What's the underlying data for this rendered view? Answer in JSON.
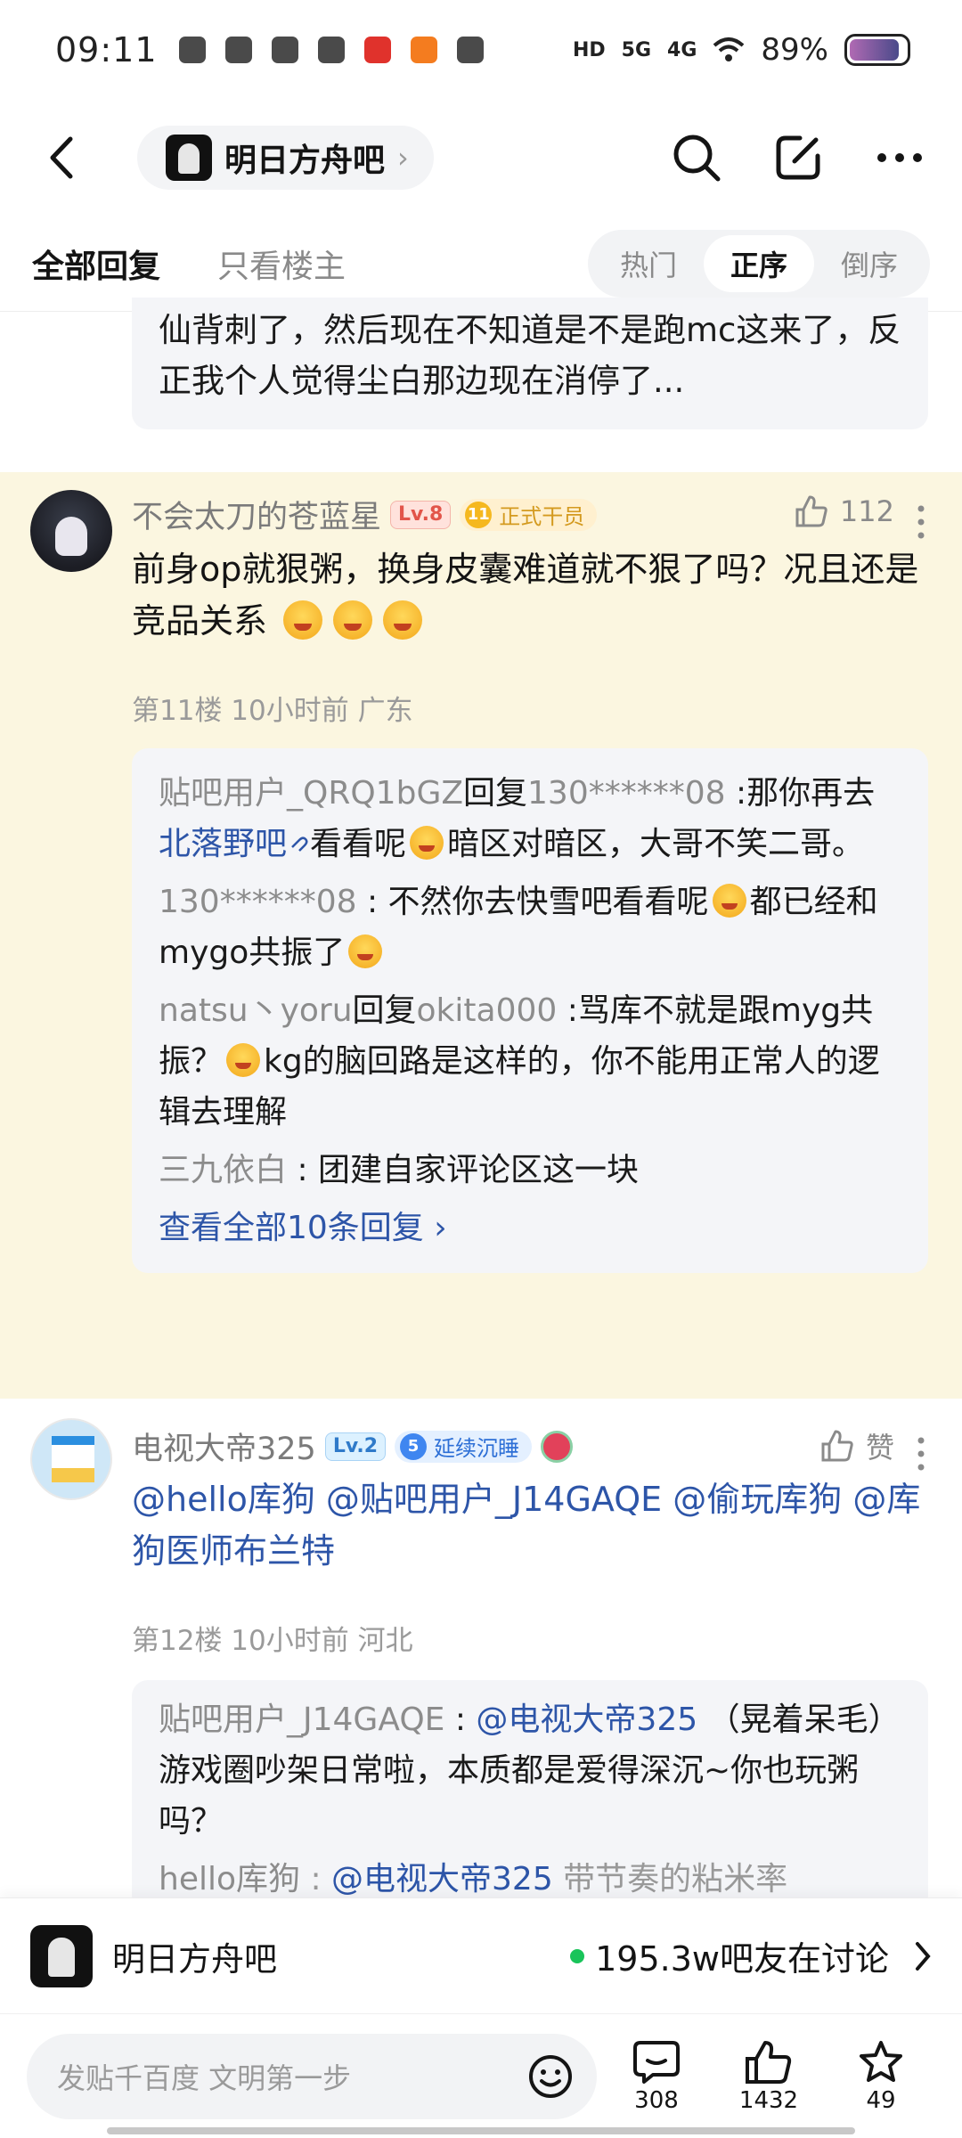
{
  "status_bar": {
    "time": "09:11",
    "signal_hd": "HD",
    "signal_5g": "5G",
    "signal_4g": "4G",
    "battery": "89%"
  },
  "nav": {
    "forum_name": "明日方舟吧"
  },
  "tabs": {
    "all_replies": "全部回复",
    "op_only": "只看楼主"
  },
  "sort": {
    "hot": "热门",
    "asc": "正序",
    "desc": "倒序",
    "active": "正序"
  },
  "prev_floor": {
    "text_tail": "仙背刺了，然后现在不知道是不是跑mc这来了，反正我个人觉得尘白那边现在消停了..."
  },
  "floor11": {
    "username": "不会太刀的苍蓝星",
    "level": "Lv.8",
    "badge_num": "11",
    "badge_title": "正式干员",
    "likes": "112",
    "content": "前身op就狠粥，换身皮囊难道就不狠了吗？况且还是竞品关系",
    "meta": "第11楼 10小时前 广东",
    "replies": [
      {
        "who": "贴吧用户_QRQ1bGZ",
        "verb": "回复",
        "target": "130******08",
        "pre": "  :那你再去",
        "link": "北落野吧",
        "post": "看看呢",
        "post2": "暗区对暗区，大哥不笑二哥。"
      },
      {
        "who": "130******08",
        "pre": " : 不然你去快雪吧看看呢",
        "post": "都已经和mygo共振了"
      },
      {
        "who": "natsu丶yoru",
        "verb": "回复",
        "target": "okita000",
        "pre": "  :骂库不就是跟myg共振？",
        "post": "kg的脑回路是这样的，你不能用正常人的逻辑去理解"
      },
      {
        "who": "三九依白",
        "pre": " : 团建自家评论区这一块"
      }
    ],
    "view_all": "查看全部10条回复 ›"
  },
  "floor12": {
    "username": "电视大帝325",
    "level": "Lv.2",
    "badge_num": "5",
    "badge_title": "延续沉睡",
    "like_label": "赞",
    "mentions": "@hello库狗  @贴吧用户_J14GAQE  @偷玩库狗  @库狗医师布兰特",
    "meta": "第12楼 10小时前 河北",
    "replies": [
      {
        "who": "贴吧用户_J14GAQE",
        "sep": " : ",
        "at": "@电视大帝325",
        "text": " （晃着呆毛）游戏圈吵架日常啦，本质都是爱得深沉~你也玩粥吗？"
      },
      {
        "who": "hello库狗",
        "sep": " : ",
        "at": "@电视大帝325",
        "text": " 带节奏的粘米率"
      }
    ]
  },
  "forum_bar": {
    "name": "明日方舟吧",
    "online": "195.3w吧友在讨论"
  },
  "input_bar": {
    "placeholder": "发贴千百度 文明第一步",
    "comments": "308",
    "likes": "1432",
    "favorites": "49"
  }
}
